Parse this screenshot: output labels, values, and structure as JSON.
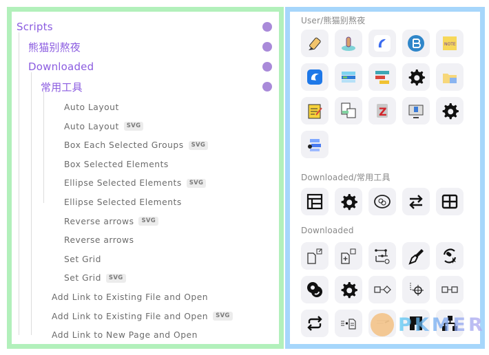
{
  "left_panel": {
    "folders": [
      {
        "label": "Scripts",
        "level": 0
      },
      {
        "label": "熊猫别熬夜",
        "level": 1
      },
      {
        "label": "Downloaded",
        "level": 1
      },
      {
        "label": "常用工具",
        "level": 2
      }
    ],
    "scripts": [
      {
        "label": "Auto Layout",
        "svg": false,
        "level": 3
      },
      {
        "label": "Auto Layout",
        "svg": true,
        "level": 3
      },
      {
        "label": "Box Each Selected Groups",
        "svg": true,
        "level": 3
      },
      {
        "label": "Box Selected Elements",
        "svg": false,
        "level": 3
      },
      {
        "label": "Ellipse Selected Elements",
        "svg": true,
        "level": 3
      },
      {
        "label": "Ellipse Selected Elements",
        "svg": false,
        "level": 3
      },
      {
        "label": "Reverse arrows",
        "svg": true,
        "level": 3
      },
      {
        "label": "Reverse arrows",
        "svg": false,
        "level": 3
      },
      {
        "label": "Set Grid",
        "svg": false,
        "level": 3
      },
      {
        "label": "Set Grid",
        "svg": true,
        "level": 3
      },
      {
        "label": "Add Link to Existing File and Open",
        "svg": false,
        "level": 2
      },
      {
        "label": "Add Link to Existing File and Open",
        "svg": true,
        "level": 2
      },
      {
        "label": "Add Link to New Page and Open",
        "svg": false,
        "level": 2
      }
    ],
    "badge_label": "SVG",
    "folder_color": "#8b5ce0",
    "dot_color": "#a98ad9"
  },
  "right_panel": {
    "sections": [
      {
        "title": "User/熊猫别熬夜",
        "icons": [
          "highlighter-icon",
          "mermaid-icon",
          "dolphin-icon",
          "blue-b-icon",
          "sticky-note-icon",
          "eagle-icon",
          "cards-icon",
          "table-flow-icon",
          "gear-icon",
          "folder-image-icon",
          "notepad-pen-icon",
          "image-text-icon",
          "zotero-icon",
          "monitor-book-icon",
          "gear-icon",
          "mindmap-blue-icon"
        ]
      },
      {
        "title": "Downloaded/常用工具",
        "icons": [
          "layout-icon",
          "gear-icon",
          "ellipse-icon",
          "reverse-arrows-icon",
          "grid-icon"
        ]
      },
      {
        "title": "Downloaded",
        "icons": [
          "file-link-icon",
          "file-add-link-icon",
          "flow-connect-icon",
          "pen-nib-icon",
          "sync-cursor-icon",
          "overlap-circles-icon",
          "gear-icon",
          "box-to-diamond-icon",
          "crosshair-dots-icon",
          "box-to-box-icon",
          "repeat-icon",
          "text-to-doc-icon",
          "egg-face-icon",
          "building-icon",
          "hierarchy-icon"
        ]
      }
    ]
  },
  "watermark": {
    "text": "PKMER"
  }
}
